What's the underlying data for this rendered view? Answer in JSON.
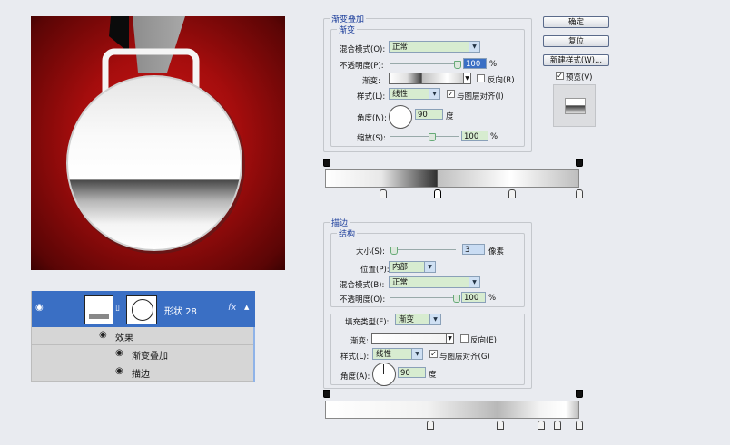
{
  "layers": {
    "layer_name": "形状 28",
    "fx": "fx",
    "effects_label": "效果",
    "effect1": "渐变叠加",
    "effect2": "描边"
  },
  "gradient_overlay": {
    "title": "渐变叠加",
    "sub_title": "渐变",
    "blend_mode_label": "混合模式(O):",
    "blend_mode": "正常",
    "opacity_label": "不透明度(P):",
    "opacity": "100",
    "opacity_unit": "%",
    "gradient_label": "渐变:",
    "reverse_label": "反向(R)",
    "style_label": "样式(L):",
    "style": "线性",
    "align_label": "与图层对齐(I)",
    "angle_label": "角度(N):",
    "angle": "90",
    "angle_unit": "度",
    "scale_label": "缩放(S):",
    "scale": "100",
    "scale_unit": "%"
  },
  "stroke": {
    "title": "描边",
    "structure_title": "结构",
    "size_label": "大小(S):",
    "size": "3",
    "size_unit": "像素",
    "position_label": "位置(P):",
    "position": "内部",
    "blend_mode_label": "混合模式(B):",
    "blend_mode": "正常",
    "opacity_label": "不透明度(O):",
    "opacity": "100",
    "opacity_unit": "%",
    "fill_type_label": "填充类型(F):",
    "fill_type": "渐变",
    "gradient_label": "渐变:",
    "reverse_label": "反向(E)",
    "style_label": "样式(L):",
    "style": "线性",
    "align_label": "与图层对齐(G)",
    "angle_label": "角度(A):",
    "angle": "90",
    "angle_unit": "度"
  },
  "buttons": {
    "ok": "确定",
    "reset": "复位",
    "new_style": "新建样式(W)...",
    "preview": "预览(V)"
  },
  "colors": {
    "canvas_red": "#a50d0d",
    "layer_selected": "#3a6fc4",
    "field_green": "#d7ecd0",
    "label_blue": "#1a3c9a"
  }
}
